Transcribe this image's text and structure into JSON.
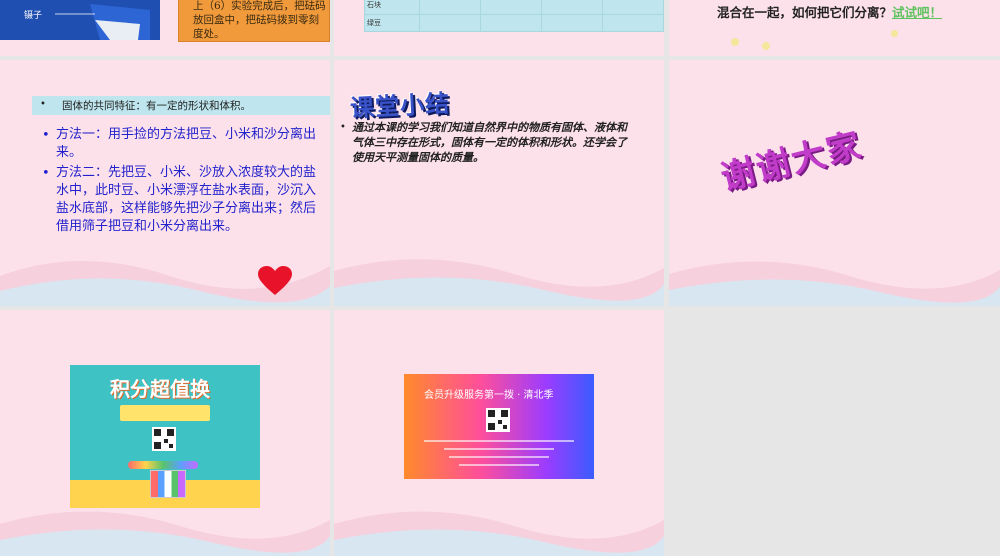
{
  "slide1": {
    "caption": "镊子",
    "orange_text": "上（6）实验完成后，把砝码放回盒中，把砝码拨到零刻度处。"
  },
  "slide2": {
    "rows": [
      "石块",
      "绿豆"
    ]
  },
  "slide3": {
    "question": "混合在一起，如何把它们分离？",
    "try_link": "试试吧！"
  },
  "slide4": {
    "feature": "固体的共同特征：有一定的形状和体积。",
    "method1": "方法一：用手捡的方法把豆、小米和沙分离出来。",
    "method2": "方法二：先把豆、小米、沙放入浓度较大的盐水中，此时豆、小米漂浮在盐水表面，沙沉入盐水底部，这样能够先把沙子分离出来；然后借用筛子把豆和小米分离出来。"
  },
  "slide5": {
    "title": "课堂小结",
    "summary": "通过本课的学习我们知道自然界中的物质有固体、液体和气体三中存在形式，固体有一定的体积和形状。还学会了使用天平测量固体的质量。"
  },
  "slide6": {
    "thanks": "谢谢大家"
  },
  "slide7": {
    "banner_title": "积分超值换"
  },
  "slide8": {
    "banner_title": "会员升级服务第一拨 · 清北季"
  },
  "colors": {
    "slide_bg": "#fde1ea",
    "text_blue": "#2222cc",
    "heading_bg": "#bfe6ee",
    "thanks_purple": "#c13cc9",
    "heart_red": "#e8132a"
  }
}
